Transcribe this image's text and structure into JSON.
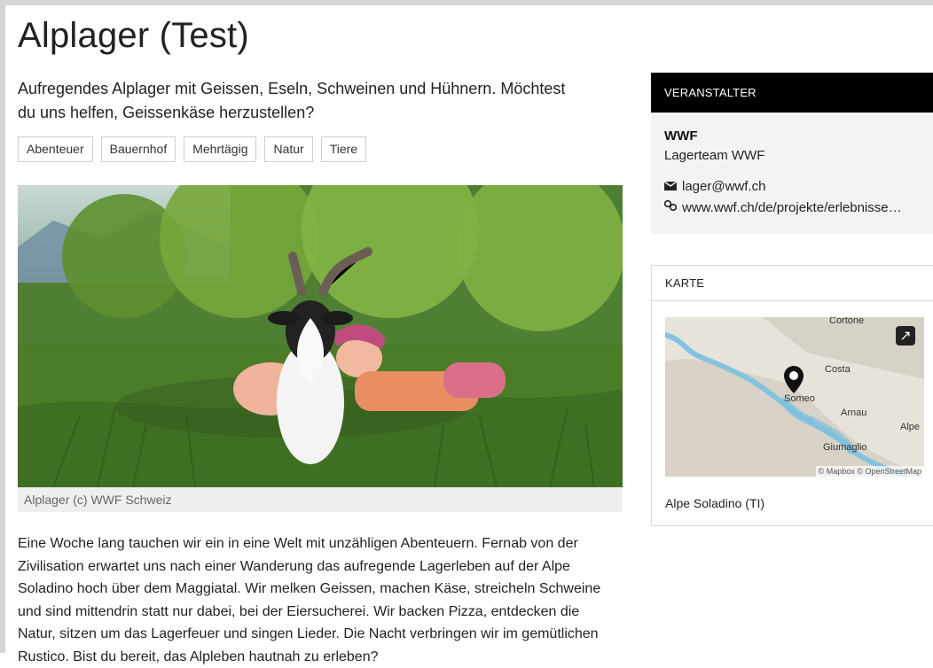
{
  "page": {
    "title": "Alplager (Test)",
    "lead": "Aufregendes Alplager mit Geissen, Eseln, Schweinen und Hühnern. Möchtest du uns helfen, Geissenkäse herzustellen?",
    "tags": [
      "Abenteuer",
      "Bauernhof",
      "Mehrtägig",
      "Natur",
      "Tiere"
    ],
    "image_caption": "Alplager (c) WWF Schweiz",
    "description": "Eine Woche lang tauchen wir ein in eine Welt mit unzähligen Abenteuern. Fernab von der Zivilisation erwartet uns nach einer Wanderung das aufregende Lagerleben auf der Alpe Soladino hoch über dem Maggiatal. Wir melken Geissen, machen Käse, streicheln Schweine und sind mittendrin statt nur dabei, bei der Eiersucherei. Wir backen Pizza, entdecken die Natur, sitzen um das Lagerfeuer und singen Lieder. Die Nacht verbringen wir im gemütlichen Rustico. Bist du bereit, das Alpleben hautnah zu erleben?"
  },
  "organizer": {
    "header": "VERANSTALTER",
    "name": "WWF",
    "team": "Lagerteam WWF",
    "email": "lager@wwf.ch",
    "website": "www.wwf.ch/de/projekte/erlebnisse…"
  },
  "map": {
    "header": "KARTE",
    "labels": {
      "top": "Cortone",
      "costa": "Costa",
      "someo": "Someo",
      "arnau": "Arnau",
      "alpe": "Alpe",
      "giumaglio": "Giumaglio"
    },
    "attribution": "© Mapbox © OpenStreetMap",
    "location": "Alpe Soladino (TI)"
  },
  "colors": {
    "black_header": "#000000",
    "panel_bg": "#f3f3f3",
    "tag_border": "#cfcfcf"
  }
}
